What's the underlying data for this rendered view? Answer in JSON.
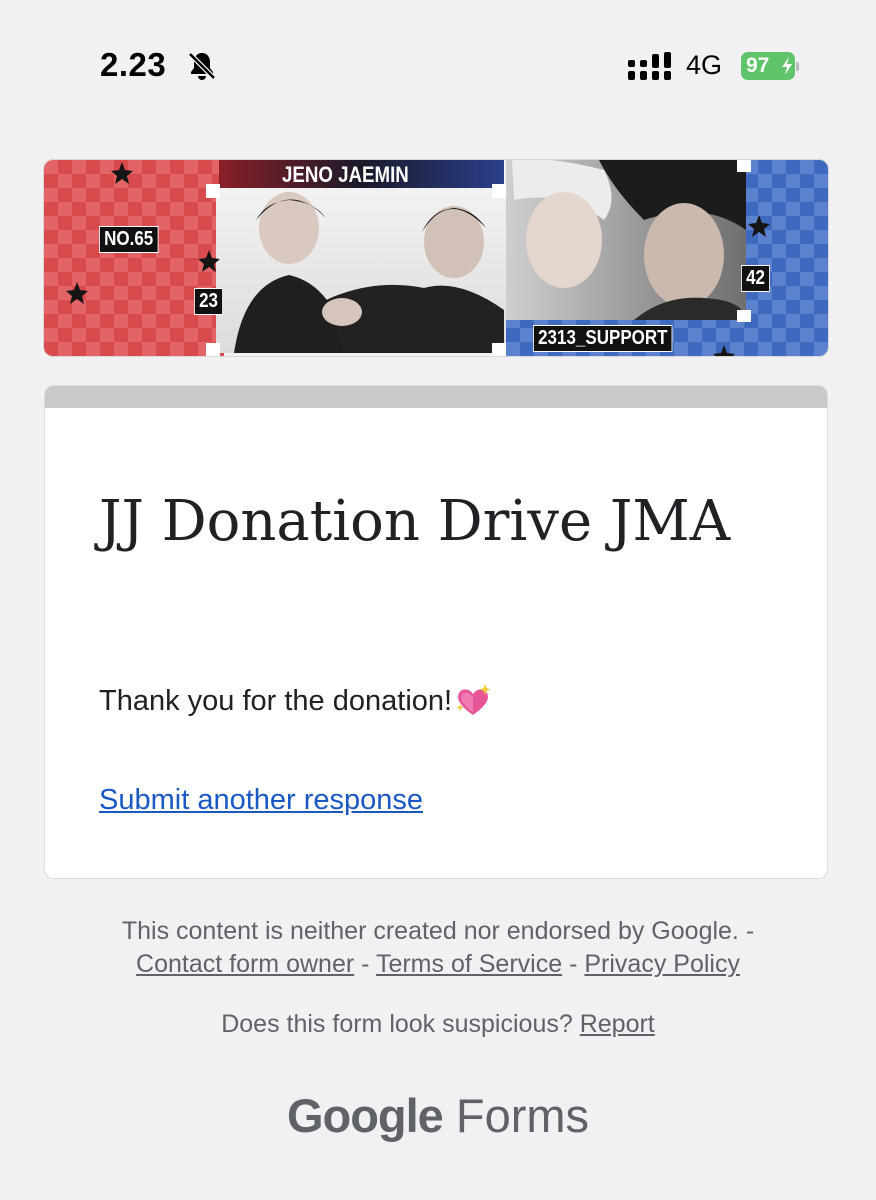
{
  "status_bar": {
    "time": "2.23",
    "network": "4G",
    "battery": "97"
  },
  "banner": {
    "title": "JENO JAEMIN",
    "number": "NO.65",
    "left_number": "23",
    "right_number": "42",
    "handle": "2313_SUPPORT"
  },
  "form": {
    "title": "JJ Donation Drive JMA",
    "confirmation_message": "Thank you for the donation!",
    "submit_another_label": "Submit another response"
  },
  "footer": {
    "disclaimer": "This content is neither created nor endorsed by Google. -",
    "contact_label": "Contact form owner",
    "terms_label": "Terms of Service",
    "privacy_label": "Privacy Policy",
    "separator": "-",
    "suspicious_text": "Does this form look suspicious?",
    "report_label": "Report"
  },
  "branding": {
    "google": "Google",
    "forms": "Forms"
  },
  "colors": {
    "banner_red": "#d8494b",
    "banner_blue": "#3f6bc0",
    "link": "#1a58c4",
    "battery_green": "#5fc46a"
  }
}
